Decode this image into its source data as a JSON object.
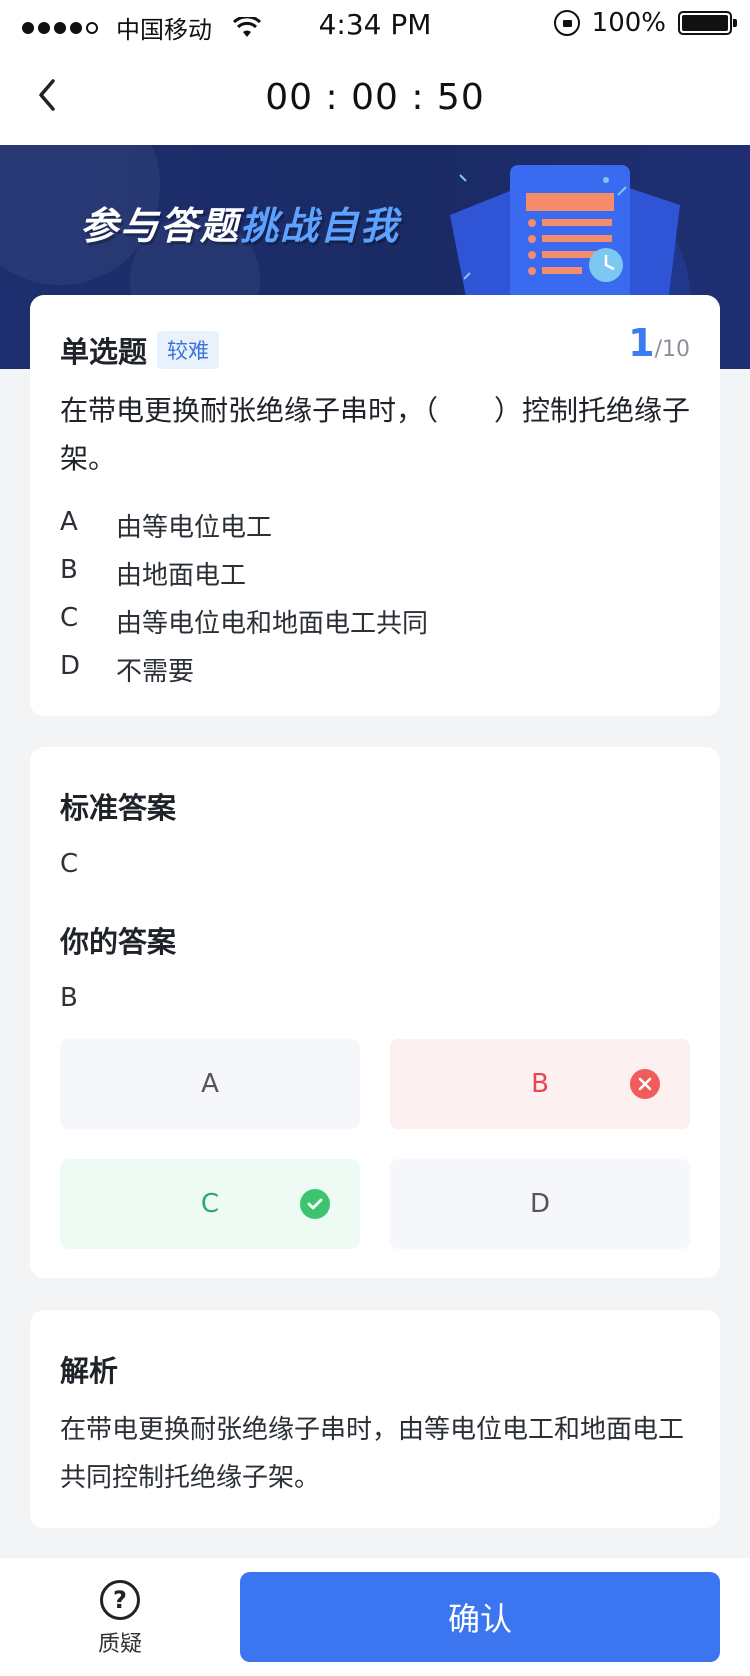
{
  "status_bar": {
    "carrier": "中国移动",
    "time": "4:34 PM",
    "battery": "100%"
  },
  "header": {
    "timer": "00 : 00 : 50"
  },
  "banner": {
    "title_main": "参与答题",
    "title_highlight": "挑战自我"
  },
  "question": {
    "type": "单选题",
    "level": "较难",
    "index_current": "1",
    "index_total": "/10",
    "stem": "在带电更换耐张绝缘子串时，（　　）控制托绝缘子架。",
    "options": [
      {
        "key": "A",
        "text": "由等电位电工"
      },
      {
        "key": "B",
        "text": "由地面电工"
      },
      {
        "key": "C",
        "text": "由等电位电和地面电工共同"
      },
      {
        "key": "D",
        "text": "不需要"
      }
    ]
  },
  "answer": {
    "standard_label": "标准答案",
    "standard_value": "C",
    "yours_label": "你的答案",
    "yours_value": "B",
    "choices": [
      "A",
      "B",
      "C",
      "D"
    ]
  },
  "explanation": {
    "title": "解析",
    "text": "在带电更换耐张绝缘子串时，由等电位电工和地面电工共同控制托绝缘子架。"
  },
  "footer": {
    "doubt_label": "质疑",
    "confirm_label": "确认"
  },
  "colors": {
    "accent": "#3b76f0",
    "banner_bg": "#1d2f6f",
    "wrong": "#f05b5b",
    "right": "#3cc46f"
  }
}
